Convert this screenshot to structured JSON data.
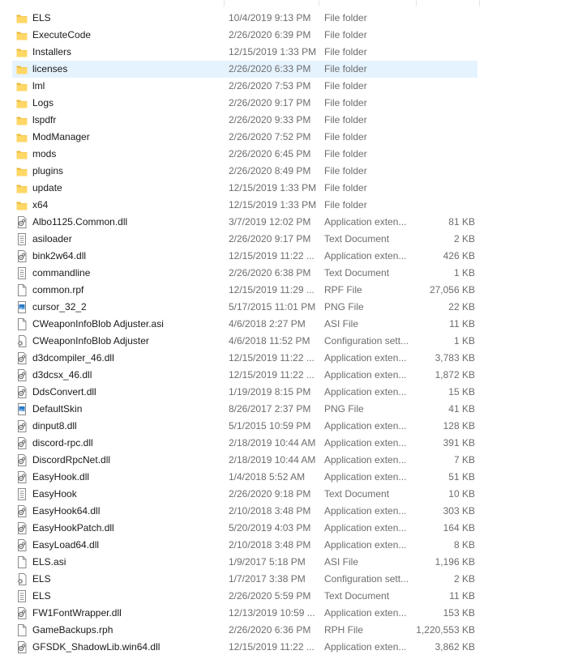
{
  "colors": {
    "folder": "#f6c94a",
    "selection": "#e5f3ff",
    "meta_text": "#6d6d6d"
  },
  "rows": [
    {
      "name": "ELS",
      "date": "10/4/2019 9:13 PM",
      "type": "File folder",
      "size": "",
      "icon": "folder-icon"
    },
    {
      "name": "ExecuteCode",
      "date": "2/26/2020 6:39 PM",
      "type": "File folder",
      "size": "",
      "icon": "folder-icon"
    },
    {
      "name": "Installers",
      "date": "12/15/2019 1:33 PM",
      "type": "File folder",
      "size": "",
      "icon": "folder-icon"
    },
    {
      "name": "licenses",
      "date": "2/26/2020 6:33 PM",
      "type": "File folder",
      "size": "",
      "icon": "folder-icon",
      "selected": true
    },
    {
      "name": "lml",
      "date": "2/26/2020 7:53 PM",
      "type": "File folder",
      "size": "",
      "icon": "folder-icon"
    },
    {
      "name": "Logs",
      "date": "2/26/2020 9:17 PM",
      "type": "File folder",
      "size": "",
      "icon": "folder-icon"
    },
    {
      "name": "lspdfr",
      "date": "2/26/2020 9:33 PM",
      "type": "File folder",
      "size": "",
      "icon": "folder-icon"
    },
    {
      "name": "ModManager",
      "date": "2/26/2020 7:52 PM",
      "type": "File folder",
      "size": "",
      "icon": "folder-icon"
    },
    {
      "name": "mods",
      "date": "2/26/2020 6:45 PM",
      "type": "File folder",
      "size": "",
      "icon": "folder-icon"
    },
    {
      "name": "plugins",
      "date": "2/26/2020 8:49 PM",
      "type": "File folder",
      "size": "",
      "icon": "folder-icon"
    },
    {
      "name": "update",
      "date": "12/15/2019 1:33 PM",
      "type": "File folder",
      "size": "",
      "icon": "folder-icon"
    },
    {
      "name": "x64",
      "date": "12/15/2019 1:33 PM",
      "type": "File folder",
      "size": "",
      "icon": "folder-icon"
    },
    {
      "name": "Albo1125.Common.dll",
      "date": "3/7/2019 12:02 PM",
      "type": "Application exten...",
      "size": "81 KB",
      "icon": "dll-icon"
    },
    {
      "name": "asiloader",
      "date": "2/26/2020 9:17 PM",
      "type": "Text Document",
      "size": "2 KB",
      "icon": "text-document-icon"
    },
    {
      "name": "bink2w64.dll",
      "date": "12/15/2019 11:22 ...",
      "type": "Application exten...",
      "size": "426 KB",
      "icon": "dll-icon"
    },
    {
      "name": "commandline",
      "date": "2/26/2020 6:38 PM",
      "type": "Text Document",
      "size": "1 KB",
      "icon": "text-document-icon"
    },
    {
      "name": "common.rpf",
      "date": "12/15/2019 11:29 ...",
      "type": "RPF File",
      "size": "27,056 KB",
      "icon": "blank-file-icon"
    },
    {
      "name": "cursor_32_2",
      "date": "5/17/2015 11:01 PM",
      "type": "PNG File",
      "size": "22 KB",
      "icon": "image-file-icon"
    },
    {
      "name": "CWeaponInfoBlob Adjuster.asi",
      "date": "4/6/2018 2:27 PM",
      "type": "ASI File",
      "size": "11 KB",
      "icon": "blank-file-icon"
    },
    {
      "name": "CWeaponInfoBlob Adjuster",
      "date": "4/6/2018 11:52 PM",
      "type": "Configuration sett...",
      "size": "1 KB",
      "icon": "config-file-icon"
    },
    {
      "name": "d3dcompiler_46.dll",
      "date": "12/15/2019 11:22 ...",
      "type": "Application exten...",
      "size": "3,783 KB",
      "icon": "dll-icon"
    },
    {
      "name": "d3dcsx_46.dll",
      "date": "12/15/2019 11:22 ...",
      "type": "Application exten...",
      "size": "1,872 KB",
      "icon": "dll-icon"
    },
    {
      "name": "DdsConvert.dll",
      "date": "1/19/2019 8:15 PM",
      "type": "Application exten...",
      "size": "15 KB",
      "icon": "dll-icon"
    },
    {
      "name": "DefaultSkin",
      "date": "8/26/2017 2:37 PM",
      "type": "PNG File",
      "size": "41 KB",
      "icon": "image-file-icon"
    },
    {
      "name": "dinput8.dll",
      "date": "5/1/2015 10:59 PM",
      "type": "Application exten...",
      "size": "128 KB",
      "icon": "dll-icon"
    },
    {
      "name": "discord-rpc.dll",
      "date": "2/18/2019 10:44 AM",
      "type": "Application exten...",
      "size": "391 KB",
      "icon": "dll-icon"
    },
    {
      "name": "DiscordRpcNet.dll",
      "date": "2/18/2019 10:44 AM",
      "type": "Application exten...",
      "size": "7 KB",
      "icon": "dll-icon"
    },
    {
      "name": "EasyHook.dll",
      "date": "1/4/2018 5:52 AM",
      "type": "Application exten...",
      "size": "51 KB",
      "icon": "dll-icon"
    },
    {
      "name": "EasyHook",
      "date": "2/26/2020 9:18 PM",
      "type": "Text Document",
      "size": "10 KB",
      "icon": "text-document-icon"
    },
    {
      "name": "EasyHook64.dll",
      "date": "2/10/2018 3:48 PM",
      "type": "Application exten...",
      "size": "303 KB",
      "icon": "dll-icon"
    },
    {
      "name": "EasyHookPatch.dll",
      "date": "5/20/2019 4:03 PM",
      "type": "Application exten...",
      "size": "164 KB",
      "icon": "dll-icon"
    },
    {
      "name": "EasyLoad64.dll",
      "date": "2/10/2018 3:48 PM",
      "type": "Application exten...",
      "size": "8 KB",
      "icon": "dll-icon"
    },
    {
      "name": "ELS.asi",
      "date": "1/9/2017 5:18 PM",
      "type": "ASI File",
      "size": "1,196 KB",
      "icon": "blank-file-icon"
    },
    {
      "name": "ELS",
      "date": "1/7/2017 3:38 PM",
      "type": "Configuration sett...",
      "size": "2 KB",
      "icon": "config-file-icon"
    },
    {
      "name": "ELS",
      "date": "2/26/2020 5:59 PM",
      "type": "Text Document",
      "size": "11 KB",
      "icon": "text-document-icon"
    },
    {
      "name": "FW1FontWrapper.dll",
      "date": "12/13/2019 10:59 ...",
      "type": "Application exten...",
      "size": "153 KB",
      "icon": "dll-icon"
    },
    {
      "name": "GameBackups.rph",
      "date": "2/26/2020 6:36 PM",
      "type": "RPH File",
      "size": "1,220,553 KB",
      "icon": "blank-file-icon"
    },
    {
      "name": "GFSDK_ShadowLib.win64.dll",
      "date": "12/15/2019 11:22 ...",
      "type": "Application exten...",
      "size": "3,862 KB",
      "icon": "dll-icon"
    }
  ]
}
